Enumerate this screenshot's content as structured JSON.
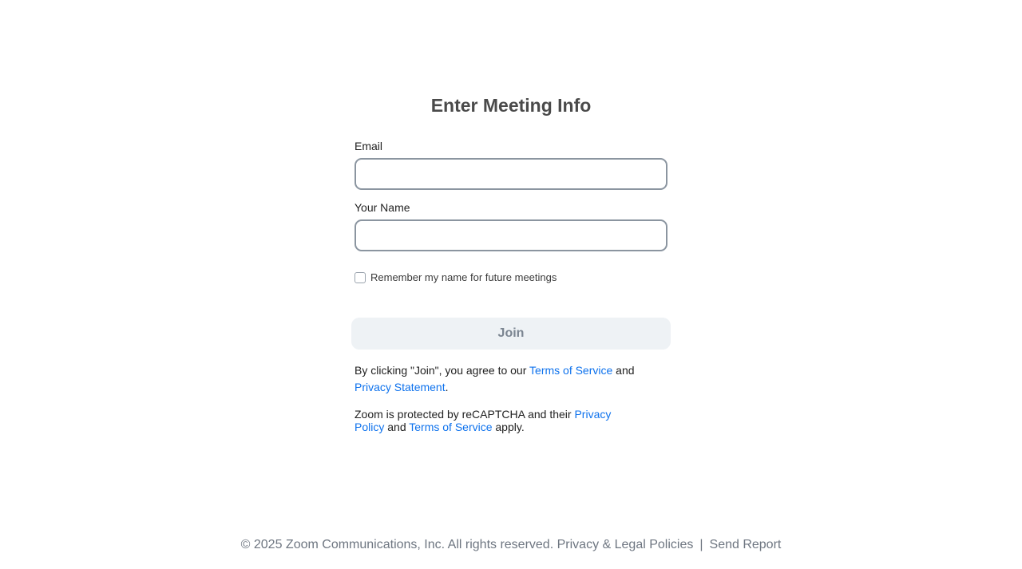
{
  "form": {
    "title": "Enter Meeting Info",
    "email_label": "Email",
    "email_value": "",
    "name_label": "Your Name",
    "name_value": "",
    "remember_label": "Remember my name for future meetings",
    "remember_checked": false,
    "join_label": "Join"
  },
  "legal": {
    "agree_prefix": "By clicking \"Join\", you agree to our",
    "terms_link": "Terms of Service",
    "and_text": "and",
    "privacy_statement_link": "Privacy Statement",
    "period": ".",
    "recaptcha_prefix": "Zoom is protected by reCAPTCHA and their",
    "privacy_policy_link": "Privacy Policy",
    "recaptcha_and": "and",
    "recaptcha_terms_link": "Terms of Service",
    "recaptcha_suffix": "apply."
  },
  "footer": {
    "copyright": "© 2025 Zoom Communications, Inc. All rights reserved.",
    "privacy_link": "Privacy & Legal Policies",
    "separator": "|",
    "report_link": "Send Report"
  },
  "colors": {
    "link": "#0e72ed",
    "title": "#4a4a4a",
    "button_bg": "#eef2f5",
    "button_text": "#7b8591",
    "footer_text": "#6e7681"
  }
}
